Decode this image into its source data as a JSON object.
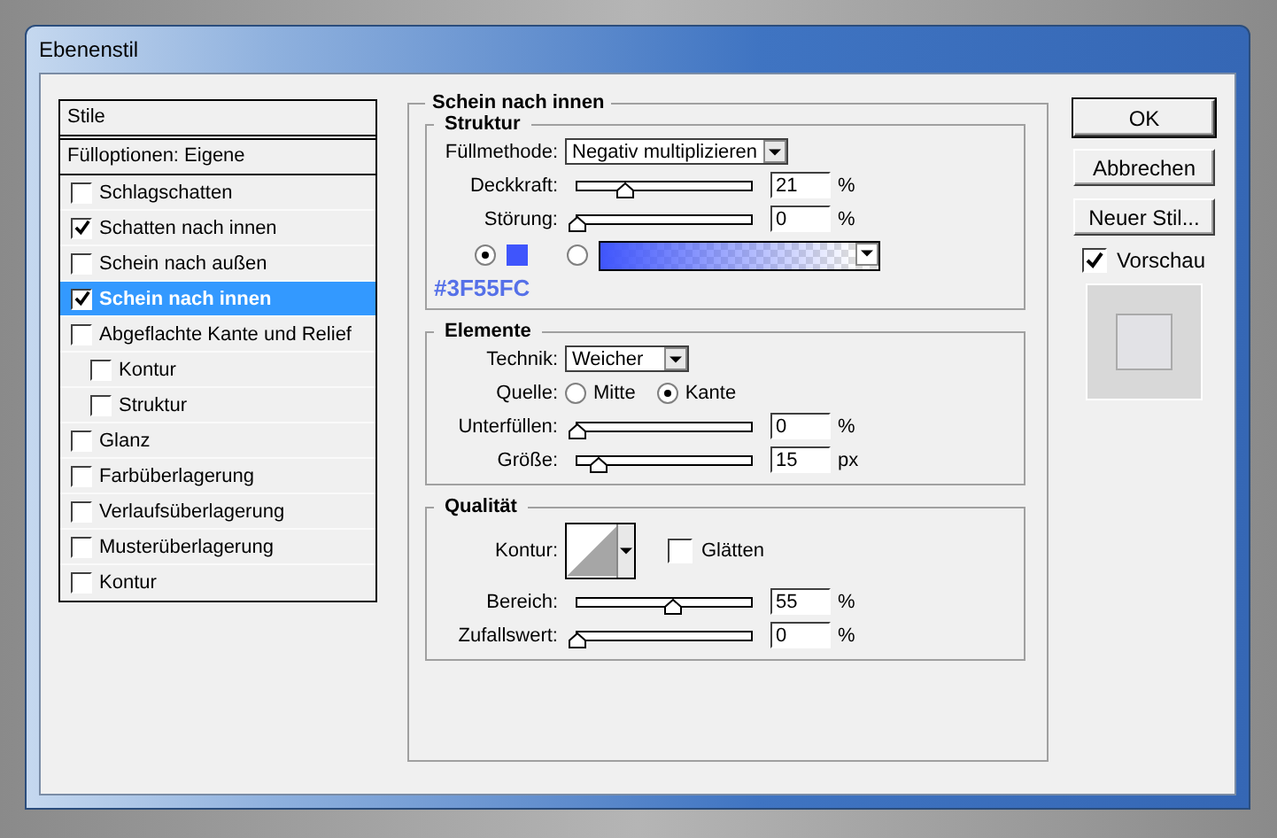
{
  "window": {
    "title": "Ebenenstil"
  },
  "styles": {
    "header": "Stile",
    "blend_options": "Fülloptionen: Eigene",
    "items": [
      {
        "label": "Schlagschatten",
        "checked": false,
        "selected": false
      },
      {
        "label": "Schatten nach innen",
        "checked": true,
        "selected": false
      },
      {
        "label": "Schein nach außen",
        "checked": false,
        "selected": false
      },
      {
        "label": "Schein nach innen",
        "checked": true,
        "selected": true
      },
      {
        "label": "Abgeflachte Kante und Relief",
        "checked": false,
        "selected": false,
        "children": [
          {
            "label": "Kontur",
            "checked": false,
            "selected": false
          },
          {
            "label": "Struktur",
            "checked": false,
            "selected": false
          }
        ]
      },
      {
        "label": "Glanz",
        "checked": false,
        "selected": false
      },
      {
        "label": "Farbüberlagerung",
        "checked": false,
        "selected": false
      },
      {
        "label": "Verlaufsüberlagerung",
        "checked": false,
        "selected": false
      },
      {
        "label": "Musterüberlagerung",
        "checked": false,
        "selected": false
      },
      {
        "label": "Kontur",
        "checked": false,
        "selected": false
      }
    ]
  },
  "panel": {
    "title": "Schein nach innen",
    "structure": {
      "title": "Struktur",
      "blend_mode": {
        "label": "Füllmethode:",
        "value": "Negativ multiplizieren"
      },
      "sliders": [
        {
          "label": "Deckkraft:",
          "level": 0.28,
          "value": "21",
          "unit": "%"
        },
        {
          "label": "Störung:",
          "level": 0,
          "value": "0",
          "unit": "%"
        }
      ],
      "color_source": [
        {
          "kind": "color",
          "selected": true,
          "color": "#3f55fc"
        },
        {
          "kind": "gradient",
          "selected": false,
          "color": "#3f55fc"
        }
      ],
      "color_note": "#3F55FC"
    },
    "elements": {
      "title": "Elemente",
      "technique": {
        "label": "Technik:",
        "value": "Weicher"
      },
      "source": {
        "label": "Quelle:",
        "options": [
          {
            "label": "Mitte",
            "selected": false
          },
          {
            "label": "Kante",
            "selected": true
          }
        ]
      },
      "sliders": [
        {
          "label": "Unterfüllen:",
          "level": 0,
          "value": "0",
          "unit": "%"
        },
        {
          "label": "Größe:",
          "level": 0.12,
          "value": "15",
          "unit": "px"
        }
      ]
    },
    "quality": {
      "title": "Qualität",
      "contour_label": "Kontur:",
      "antialias": {
        "label": "Glätten",
        "checked": false
      },
      "sliders": [
        {
          "label": "Bereich:",
          "level": 0.55,
          "value": "55",
          "unit": "%"
        },
        {
          "label": "Zufallswert:",
          "level": 0,
          "value": "0",
          "unit": "%"
        }
      ]
    }
  },
  "buttons": [
    {
      "label": "OK",
      "kind": "default"
    },
    {
      "label": "Abbrechen",
      "kind": "normal"
    },
    {
      "label": "Neuer Stil...",
      "kind": "normal"
    }
  ],
  "preview": {
    "label": "Vorschau",
    "checked": true
  }
}
